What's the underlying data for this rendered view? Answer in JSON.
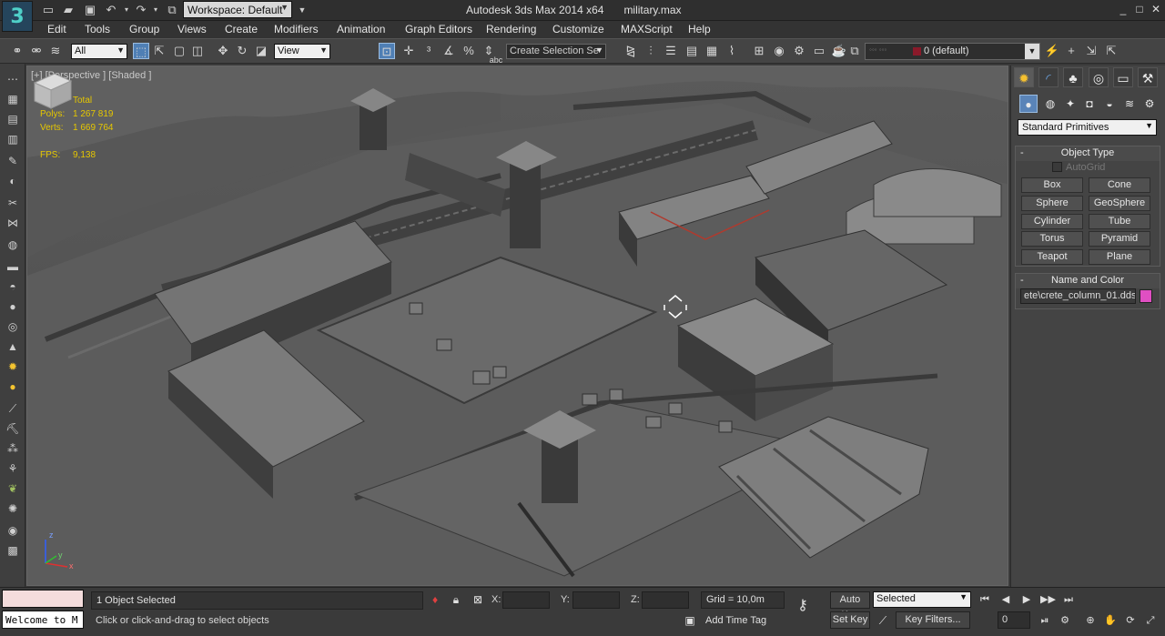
{
  "titlebar": {
    "workspace": "Workspace: Default",
    "app_name": "Autodesk 3ds Max  2014 x64",
    "file_name": "military.max",
    "logo_glyph": "3"
  },
  "menu": [
    "Edit",
    "Tools",
    "Group",
    "Views",
    "Create",
    "Modifiers",
    "Animation",
    "Graph Editors",
    "Rendering",
    "Customize",
    "MAXScript",
    "Help"
  ],
  "toolbar": {
    "filter": "All",
    "ref_coord": "View",
    "named_selection": "Create Selection Se",
    "layer": "0 (default)"
  },
  "viewport": {
    "label": "[+] [Perspective ] [Shaded ]",
    "stats": {
      "total_label": "Total",
      "polys_label": "Polys:",
      "polys": "1 267 819",
      "verts_label": "Verts:",
      "verts": "1 669 764",
      "fps_label": "FPS:",
      "fps": "9,138"
    },
    "axis": {
      "x": "x",
      "y": "y",
      "z": "z"
    }
  },
  "command_panel": {
    "primitive_type": "Standard Primitives",
    "object_type_title": "Object Type",
    "autogrid_label": "AutoGrid",
    "buttons": [
      "Box",
      "Cone",
      "Sphere",
      "GeoSphere",
      "Cylinder",
      "Tube",
      "Torus",
      "Pyramid",
      "Teapot",
      "Plane"
    ],
    "name_color_title": "Name and Color",
    "object_name": "ete\\crete_column_01.dds",
    "object_color": "#e04fc2"
  },
  "status": {
    "listener_text": "Welcome to M",
    "selection": "1 Object Selected",
    "prompt": "Click or click-and-drag to select objects",
    "x_label": "X:",
    "y_label": "Y:",
    "z_label": "Z:",
    "grid": "Grid = 10,0m",
    "add_time_tag": "Add Time Tag",
    "auto_key": "Auto Key",
    "set_key": "Set Key",
    "selected_mode": "Selected",
    "key_filters": "Key Filters...",
    "frame": "0"
  }
}
